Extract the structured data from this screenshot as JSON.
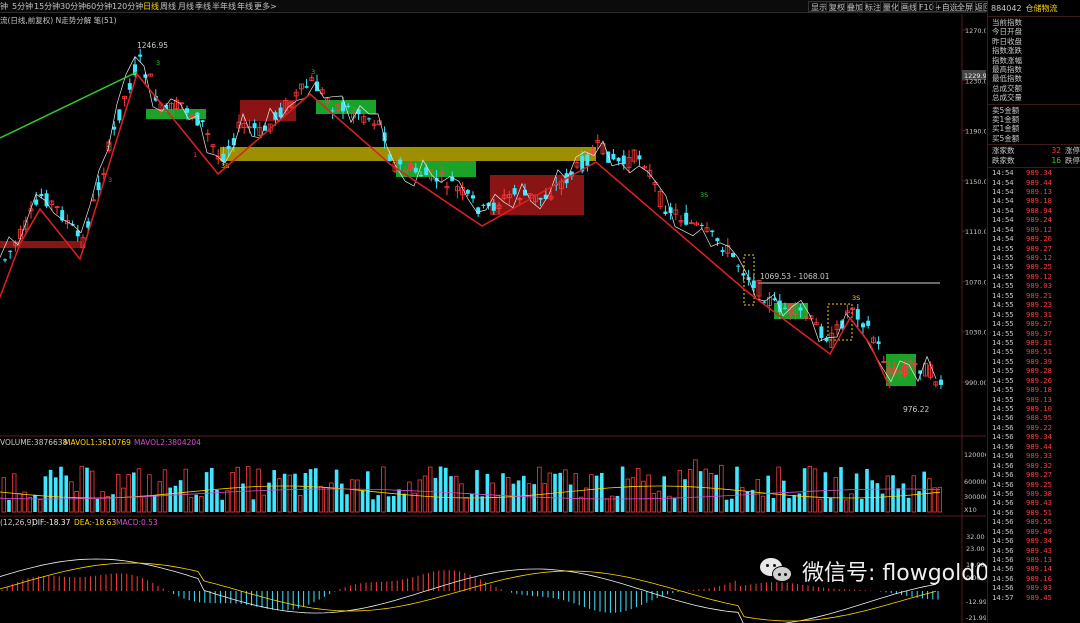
{
  "topbar": {
    "timeframes": [
      {
        "label": "钟",
        "active": false
      },
      {
        "label": "5分钟",
        "active": false
      },
      {
        "label": "15分钟",
        "active": false
      },
      {
        "label": "30分钟",
        "active": false
      },
      {
        "label": "60分钟",
        "active": false
      },
      {
        "label": "120分钟",
        "active": false
      },
      {
        "label": "日线",
        "active": true
      },
      {
        "label": "周线",
        "active": false
      },
      {
        "label": "月线",
        "active": false
      },
      {
        "label": "季线",
        "active": false
      },
      {
        "label": "半年线",
        "active": false
      },
      {
        "label": "年线",
        "active": false
      },
      {
        "label": "更多>",
        "active": false
      }
    ],
    "tools": [
      "显示",
      "复权",
      "叠加",
      "标注",
      "量化",
      "画线",
      "F10",
      "+自选",
      "全屏",
      "返回"
    ]
  },
  "main_chart": {
    "legend": "流(日线,前复权) N走势分解 笔(51)",
    "high_label": "1246.95",
    "low_label": "976.22",
    "range_label": "1069.53 - 1068.01",
    "current_price_tag": "1229.96",
    "y_ticks": [
      "1270.00",
      "1230.00",
      "1190.00",
      "1150.00",
      "1110.00",
      "1070.00",
      "1030.00",
      "990.00"
    ],
    "point_labels": [
      {
        "text": "2",
        "color": "#2ecc40"
      },
      {
        "text": "3",
        "color": "#2ecc40"
      },
      {
        "text": "3",
        "color": "#2ecc40"
      },
      {
        "text": "3B",
        "color": "#ffd400"
      },
      {
        "text": "3S",
        "color": "#2ecc40"
      },
      {
        "text": "3S",
        "color": "#ffd400"
      },
      {
        "text": "1",
        "color": "#ff3b3b"
      },
      {
        "text": "3",
        "color": "#ff3b3b"
      }
    ]
  },
  "volume_panel": {
    "volume_label": "VOLUME:3876638",
    "mavol1_label": "MAVOL1:3610769",
    "mavol2_label": "MAVOL2:3804204",
    "y_ticks": [
      "1200000",
      "600000",
      "300000"
    ],
    "multiplier": "X10"
  },
  "macd_panel": {
    "params_label": "(12,26,9)",
    "dif_label": "DIF:-18.37",
    "dea_label": "DEA:-18.63",
    "macd_label": "MACD:0.53",
    "y_ticks": [
      "32.00",
      "23.00",
      "10.00",
      "0.00",
      "-12.99",
      "-21.99"
    ]
  },
  "sidebar": {
    "code": "884042",
    "name": "仓储物流",
    "index_fields": [
      "当前指数",
      "今日开盘",
      "昨日收盘",
      "指数涨跌",
      "指数涨幅",
      "最高指数",
      "最低指数",
      "总成交额",
      "总成交量"
    ],
    "order_fields": [
      "卖5金额",
      "卖1金额",
      "买1金额",
      "买5金额"
    ],
    "rise_label": "涨家数",
    "rise_count": "32",
    "rise_flat": "涨停",
    "fall_label": "跌家数",
    "fall_count": "16",
    "fall_flat": "跌停",
    "ticks": [
      {
        "t": "14:54",
        "p": "989.34"
      },
      {
        "t": "14:54",
        "p": "989.44"
      },
      {
        "t": "14:54",
        "p": "989.13"
      },
      {
        "t": "14:54",
        "p": "989.18"
      },
      {
        "t": "14:54",
        "p": "988.94"
      },
      {
        "t": "14:54",
        "p": "989.24"
      },
      {
        "t": "14:54",
        "p": "989.12"
      },
      {
        "t": "14:54",
        "p": "989.26"
      },
      {
        "t": "14:55",
        "p": "989.27"
      },
      {
        "t": "14:55",
        "p": "989.12"
      },
      {
        "t": "14:55",
        "p": "989.25"
      },
      {
        "t": "14:55",
        "p": "989.12"
      },
      {
        "t": "14:55",
        "p": "989.03"
      },
      {
        "t": "14:55",
        "p": "989.21"
      },
      {
        "t": "14:55",
        "p": "989.23"
      },
      {
        "t": "14:55",
        "p": "989.31"
      },
      {
        "t": "14:55",
        "p": "989.27"
      },
      {
        "t": "14:55",
        "p": "989.37"
      },
      {
        "t": "14:55",
        "p": "989.31"
      },
      {
        "t": "14:55",
        "p": "989.51"
      },
      {
        "t": "14:55",
        "p": "989.39"
      },
      {
        "t": "14:55",
        "p": "989.28"
      },
      {
        "t": "14:55",
        "p": "989.26"
      },
      {
        "t": "14:55",
        "p": "989.18"
      },
      {
        "t": "14:55",
        "p": "989.13"
      },
      {
        "t": "14:55",
        "p": "989.10"
      },
      {
        "t": "14:56",
        "p": "988.95"
      },
      {
        "t": "14:56",
        "p": "989.22"
      },
      {
        "t": "14:56",
        "p": "989.34"
      },
      {
        "t": "14:56",
        "p": "989.44"
      },
      {
        "t": "14:56",
        "p": "989.33"
      },
      {
        "t": "14:56",
        "p": "989.32"
      },
      {
        "t": "14:56",
        "p": "989.27"
      },
      {
        "t": "14:56",
        "p": "989.25"
      },
      {
        "t": "14:56",
        "p": "989.38"
      },
      {
        "t": "14:56",
        "p": "989.43"
      },
      {
        "t": "14:56",
        "p": "989.51"
      },
      {
        "t": "14:56",
        "p": "989.55"
      },
      {
        "t": "14:56",
        "p": "989.49"
      },
      {
        "t": "14:56",
        "p": "989.34"
      },
      {
        "t": "14:56",
        "p": "989.43"
      },
      {
        "t": "14:56",
        "p": "989.13"
      },
      {
        "t": "14:56",
        "p": "989.14"
      },
      {
        "t": "14:56",
        "p": "989.16"
      },
      {
        "t": "14:56",
        "p": "989.03"
      },
      {
        "t": "14:57",
        "p": "989.45"
      }
    ]
  },
  "watermark": {
    "text": "微信号: flowgold00"
  },
  "colors": {
    "up": "#ff3b3b",
    "down": "#3ee6ff",
    "pivot_red": "#a01818",
    "pivot_green": "#1fbf2f",
    "pivot_yellow": "#b8a800",
    "dif": "#f0f0f0",
    "dea": "#ffd400",
    "mavol2": "#d050d0"
  }
}
